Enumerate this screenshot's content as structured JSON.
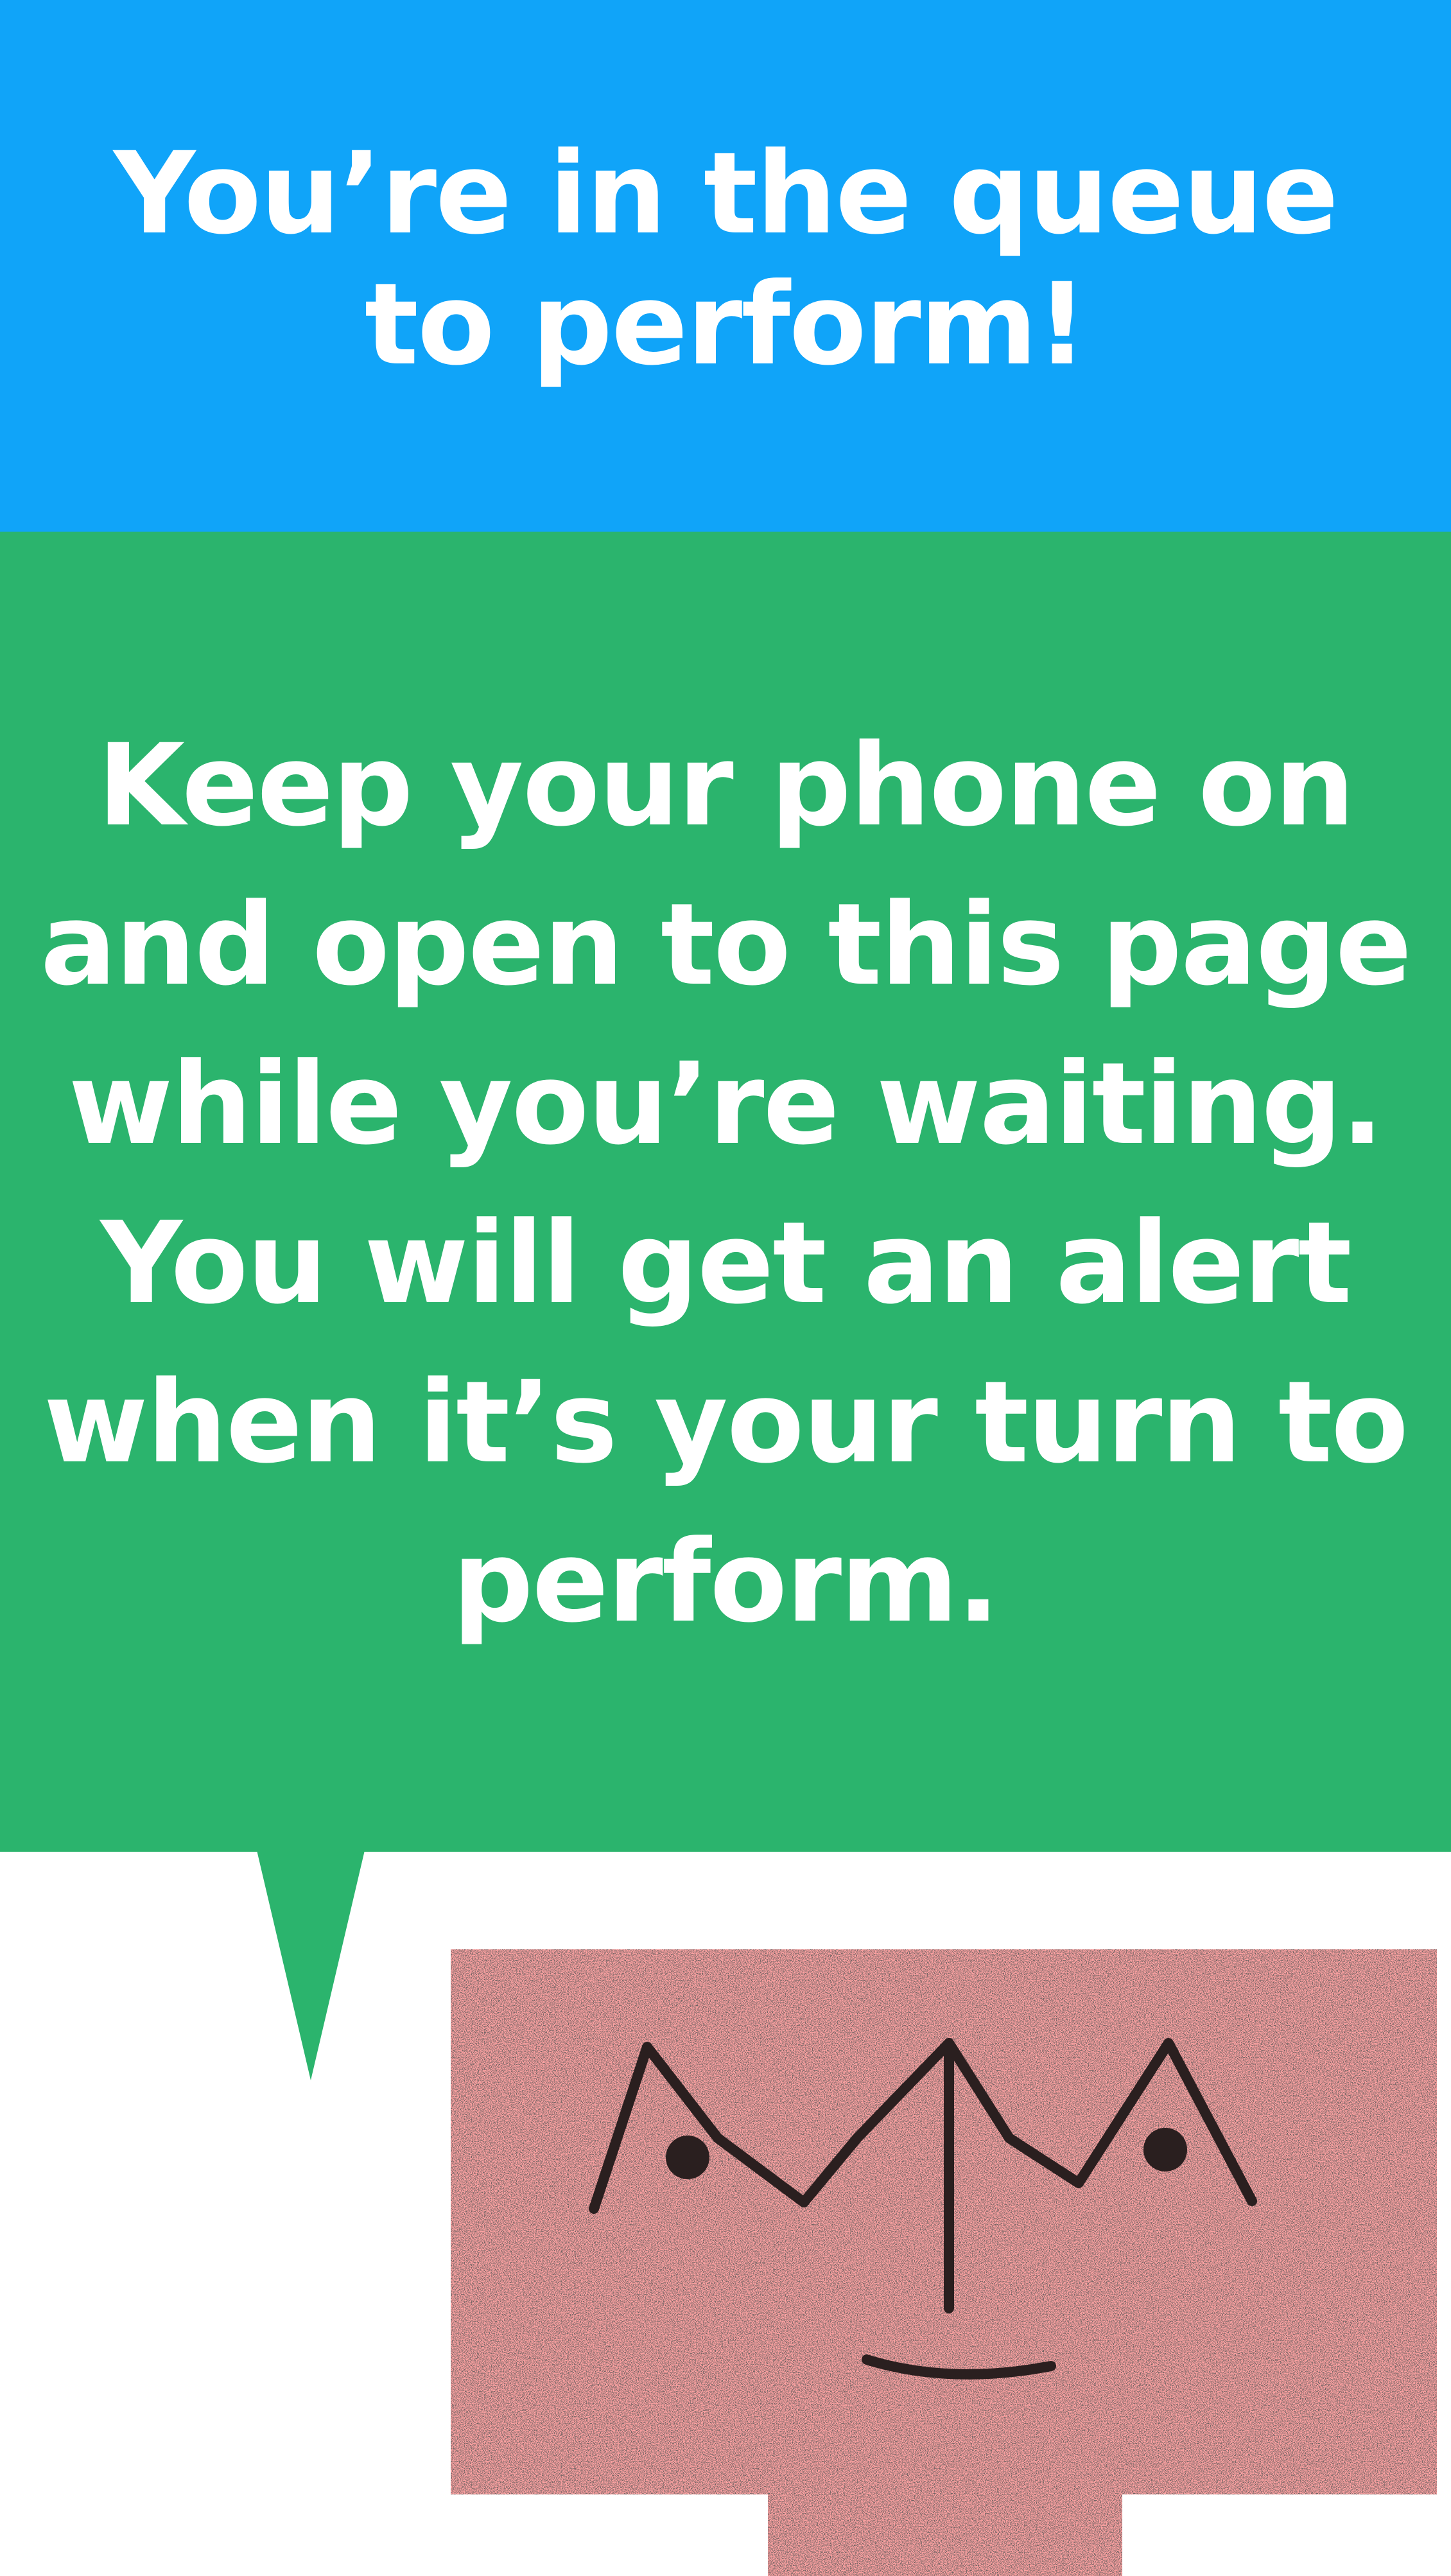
{
  "header": {
    "title": "You’re in the queue to perform!"
  },
  "message": {
    "text": "Keep your phone on and open to this page while you’re waiting. You will get an alert when it’s your turn to perform."
  },
  "colors": {
    "header_bg": "#10a4f9",
    "message_bg": "#2bb46d",
    "avatar_bg": "#ffa3a3",
    "ink": "#2a1f1f"
  },
  "icons": {
    "speech_tail": "speech-bubble-tail-icon",
    "avatar": "smiling-face-avatar-icon"
  }
}
